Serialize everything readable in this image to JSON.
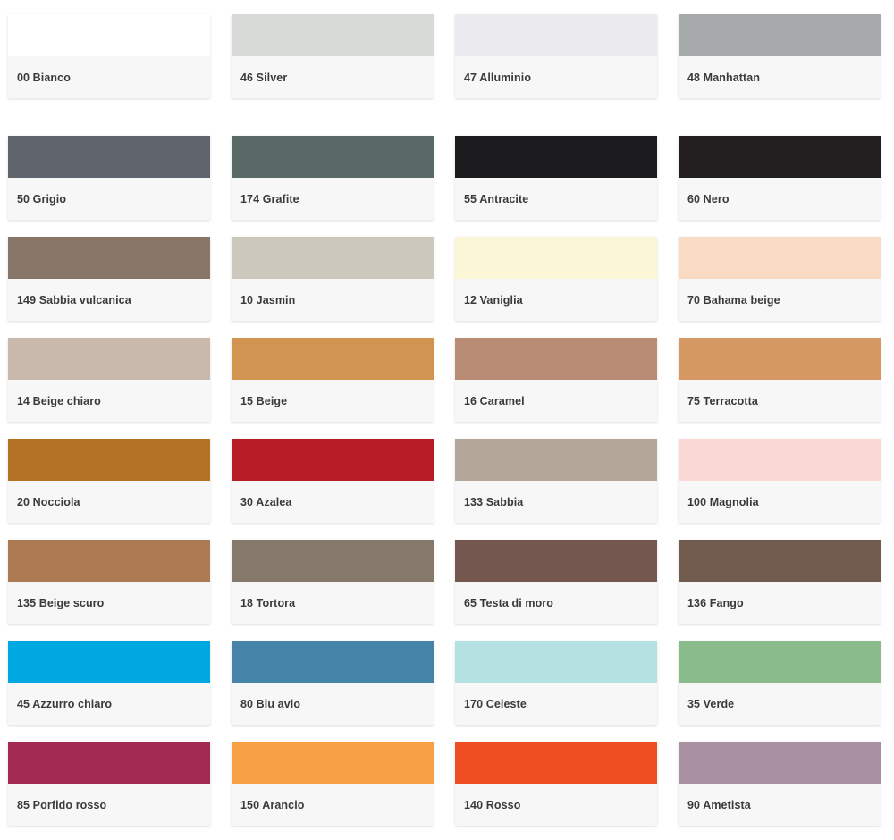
{
  "rows": [
    [
      {
        "label": "00 Bianco",
        "color": "#ffffff"
      },
      {
        "label": "46 Silver",
        "color": "#d8dad7"
      },
      {
        "label": "47 Alluminio",
        "color": "#ebebef"
      },
      {
        "label": "48 Manhattan",
        "color": "#a6aaab"
      }
    ],
    [
      {
        "label": "50 Grigio",
        "color": "#5e636c"
      },
      {
        "label": "174 Grafite",
        "color": "#586966"
      },
      {
        "label": "55 Antracite",
        "color": "#1c1b1d"
      },
      {
        "label": "60 Nero",
        "color": "#231f20"
      }
    ],
    [
      {
        "label": "149 Sabbia vulcanica",
        "color": "#887768"
      },
      {
        "label": "10 Jasmin",
        "color": "#ccc8bd"
      },
      {
        "label": "12 Vaniglia",
        "color": "#fbf6d5"
      },
      {
        "label": "70 Bahama beige",
        "color": "#f9dbc3"
      }
    ],
    [
      {
        "label": "14 Beige chiaro",
        "color": "#c9b9ad"
      },
      {
        "label": "15 Beige",
        "color": "#d29551"
      },
      {
        "label": "16 Caramel",
        "color": "#b98c75"
      },
      {
        "label": "75 Terracotta",
        "color": "#d59862"
      }
    ],
    [
      {
        "label": "20 Nocciola",
        "color": "#b37226"
      },
      {
        "label": "30 Azalea",
        "color": "#b71b26"
      },
      {
        "label": "133 Sabbia",
        "color": "#b4a698"
      },
      {
        "label": "100 Magnolia",
        "color": "#f9d8d6"
      }
    ],
    [
      {
        "label": "135 Beige scuro",
        "color": "#ac7b53"
      },
      {
        "label": "18 Tortora",
        "color": "#85796b"
      },
      {
        "label": "65 Testa di moro",
        "color": "#74574e"
      },
      {
        "label": "136 Fango",
        "color": "#725c50"
      }
    ],
    [
      {
        "label": "45 Azzurro chiaro",
        "color": "#00a8e2"
      },
      {
        "label": "80 Blu avio",
        "color": "#4583a8"
      },
      {
        "label": "170 Celeste",
        "color": "#b4e1e1"
      },
      {
        "label": "35 Verde",
        "color": "#8abb8d"
      }
    ],
    [
      {
        "label": "85 Porfido rosso",
        "color": "#a22a53"
      },
      {
        "label": "150 Arancio",
        "color": "#f8a045"
      },
      {
        "label": "140 Rosso",
        "color": "#ef4e23"
      },
      {
        "label": "90 Ametista",
        "color": "#a892a2"
      }
    ]
  ]
}
